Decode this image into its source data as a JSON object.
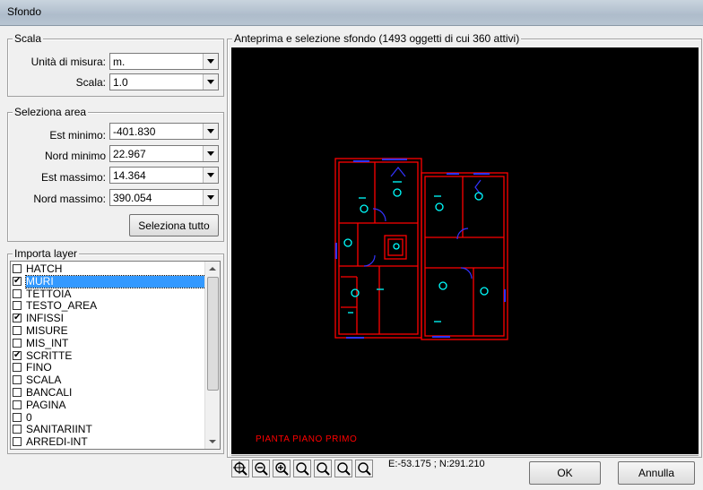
{
  "window": {
    "title": "Sfondo"
  },
  "scala_group": {
    "legend": "Scala",
    "unita_label": "Unità di misura:",
    "unita_value": "m.",
    "scala_label": "Scala:",
    "scala_value": "1.0"
  },
  "area_group": {
    "legend": "Seleziona area",
    "est_min_label": "Est minimo:",
    "est_min_value": "-401.830",
    "nord_min_label": "Nord minimo",
    "nord_min_value": "22.967",
    "est_max_label": "Est massimo:",
    "est_max_value": "14.364",
    "nord_max_label": "Nord massimo:",
    "nord_max_value": "390.054",
    "select_all_label": "Seleziona tutto"
  },
  "layer_group": {
    "legend": "Importa layer",
    "layers": [
      {
        "name": "HATCH",
        "checked": false,
        "selected": false
      },
      {
        "name": "MURI",
        "checked": true,
        "selected": true
      },
      {
        "name": "TETTOIA",
        "checked": false,
        "selected": false
      },
      {
        "name": "TESTO_AREA",
        "checked": false,
        "selected": false
      },
      {
        "name": "INFISSI",
        "checked": true,
        "selected": false
      },
      {
        "name": "MISURE",
        "checked": false,
        "selected": false
      },
      {
        "name": "MIS_INT",
        "checked": false,
        "selected": false
      },
      {
        "name": "SCRITTE",
        "checked": true,
        "selected": false
      },
      {
        "name": "FINO",
        "checked": false,
        "selected": false
      },
      {
        "name": "SCALA",
        "checked": false,
        "selected": false
      },
      {
        "name": "BANCALI",
        "checked": false,
        "selected": false
      },
      {
        "name": "PAGINA",
        "checked": false,
        "selected": false
      },
      {
        "name": "0",
        "checked": false,
        "selected": false
      },
      {
        "name": "SANITARIINT",
        "checked": false,
        "selected": false
      },
      {
        "name": "ARREDI-INT",
        "checked": false,
        "selected": false
      }
    ]
  },
  "preview": {
    "title": "Anteprima e selezione sfondo (1493 oggetti di cui 360 attivi)",
    "plan_caption": "PIANTA PIANO PRIMO",
    "coords": "E:-53.175 ; N:291.210",
    "colors": {
      "walls": "#ff0000",
      "fixtures": "#00ffff",
      "windows": "#0000ff",
      "background": "#000000"
    }
  },
  "zoom_tools": [
    "zoom-extents-icon",
    "zoom-out-icon",
    "zoom-in-icon",
    "zoom-window-icon",
    "zoom-previous-icon",
    "zoom-realtime-icon",
    "zoom-all-icon"
  ],
  "buttons": {
    "ok": "OK",
    "cancel": "Annulla"
  }
}
